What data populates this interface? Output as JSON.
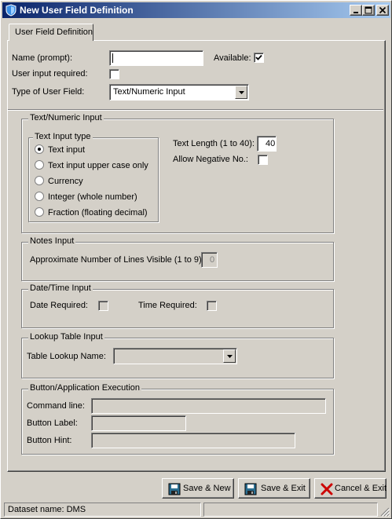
{
  "window": {
    "title": "New User Field Definition"
  },
  "tabs": [
    {
      "label": "User Field Definition",
      "active": true
    }
  ],
  "header_form": {
    "name_label": "Name (prompt):",
    "name_value": "",
    "available_label": "Available:",
    "available_checked": true,
    "input_required_label": "User input required:",
    "input_required_checked": false,
    "type_label": "Type of User Field:",
    "type_value": "Text/Numeric Input"
  },
  "text_numeric": {
    "title": "Text/Numeric Input",
    "input_type_title": "Text Input type",
    "options": [
      {
        "label": "Text input",
        "selected": true
      },
      {
        "label": "Text input upper case only",
        "selected": false
      },
      {
        "label": "Currency",
        "selected": false
      },
      {
        "label": "Integer (whole number)",
        "selected": false
      },
      {
        "label": "Fraction (floating decimal)",
        "selected": false
      }
    ],
    "text_length_label": "Text Length (1 to 40):",
    "text_length_value": "40",
    "allow_negative_label": "Allow Negative No.:",
    "allow_negative_checked": false
  },
  "notes_input": {
    "title": "Notes Input",
    "lines_label": "Approximate Number of Lines Visible (1 to 9):",
    "lines_value": "0"
  },
  "date_time": {
    "title": "Date/Time Input",
    "date_label": "Date Required:",
    "time_label": "Time Required:"
  },
  "lookup": {
    "title": "Lookup Table Input",
    "name_label": "Table Lookup  Name:",
    "name_value": ""
  },
  "button_exec": {
    "title": "Button/Application Execution",
    "command_label": "Command line:",
    "command_value": "",
    "label_label": "Button Label:",
    "label_value": "",
    "hint_label": "Button Hint:",
    "hint_value": ""
  },
  "actions": {
    "save_new": "Save & New",
    "save_exit": "Save & Exit",
    "cancel_exit": "Cancel & Exit"
  },
  "status": {
    "dataset": "Dataset name:  DMS"
  },
  "colors": {
    "face": "#d4d0c8",
    "title_start": "#0a246a",
    "title_end": "#a6caf0",
    "cancel_x": "#cc0000"
  }
}
